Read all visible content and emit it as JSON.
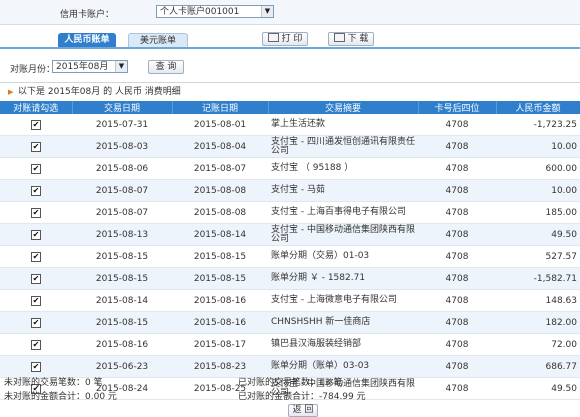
{
  "header": {
    "account_label": "信用卡账户：",
    "account_value": "个人卡账户001001"
  },
  "tabs": [
    {
      "label": "人民币账单",
      "active": true
    },
    {
      "label": "美元账单",
      "active": false
    }
  ],
  "toolbar": {
    "print_label": "打 印",
    "download_label": "下 载"
  },
  "query": {
    "month_label": "对账月份：",
    "month_value": "2015年08月",
    "query_label": "查 询"
  },
  "caption": "以下是 2015年08月 的 人民币 消费明细",
  "table": {
    "headers": [
      "对账请勾选",
      "交易日期",
      "记账日期",
      "交易摘要",
      "卡号后四位",
      "人民币金额"
    ],
    "rows": [
      {
        "checked": true,
        "trade_date": "2015-07-31",
        "post_date": "2015-08-01",
        "desc": "掌上生活还款",
        "card": "4708",
        "amount": "-1,723.25"
      },
      {
        "checked": true,
        "trade_date": "2015-08-03",
        "post_date": "2015-08-04",
        "desc": "支付宝 - 四川通发恒创通讯有限责任公司",
        "card": "4708",
        "amount": "10.00"
      },
      {
        "checked": true,
        "trade_date": "2015-08-06",
        "post_date": "2015-08-07",
        "desc": "支付宝 （ 95188 ）",
        "card": "4708",
        "amount": "600.00"
      },
      {
        "checked": true,
        "trade_date": "2015-08-07",
        "post_date": "2015-08-08",
        "desc": "支付宝 - 马茹",
        "card": "4708",
        "amount": "10.00"
      },
      {
        "checked": true,
        "trade_date": "2015-08-07",
        "post_date": "2015-08-08",
        "desc": "支付宝 - 上海百事得电子有限公司",
        "card": "4708",
        "amount": "185.00"
      },
      {
        "checked": true,
        "trade_date": "2015-08-13",
        "post_date": "2015-08-14",
        "desc": "支付宝 - 中国移动通信集团陕西有限公司",
        "card": "4708",
        "amount": "49.50"
      },
      {
        "checked": true,
        "trade_date": "2015-08-15",
        "post_date": "2015-08-15",
        "desc": "账单分期（交易）01-03",
        "card": "4708",
        "amount": "527.57"
      },
      {
        "checked": true,
        "trade_date": "2015-08-15",
        "post_date": "2015-08-15",
        "desc": "账单分期 ￥ - 1582.71",
        "card": "4708",
        "amount": "-1,582.71"
      },
      {
        "checked": true,
        "trade_date": "2015-08-14",
        "post_date": "2015-08-16",
        "desc": "支付宝 - 上海微意电子有限公司",
        "card": "4708",
        "amount": "148.63"
      },
      {
        "checked": true,
        "trade_date": "2015-08-15",
        "post_date": "2015-08-16",
        "desc": "CHNSHSHH 新一佳商店",
        "card": "4708",
        "amount": "182.00"
      },
      {
        "checked": true,
        "trade_date": "2015-08-16",
        "post_date": "2015-08-17",
        "desc": "镇巴县汉海服装经销部",
        "card": "4708",
        "amount": "72.00"
      },
      {
        "checked": true,
        "trade_date": "2015-06-23",
        "post_date": "2015-08-23",
        "desc": "账单分期（账单）03-03",
        "card": "4708",
        "amount": "686.77"
      },
      {
        "checked": true,
        "trade_date": "2015-08-24",
        "post_date": "2015-08-25",
        "desc": "支付宝 - 中国移动通信集团陕西有限公司",
        "card": "4708",
        "amount": "49.50"
      }
    ]
  },
  "summary": {
    "unchecked_count_label": "未对账的交易笔数：",
    "unchecked_count": "0 笔",
    "unchecked_total_label": "未对账的金额合计：",
    "unchecked_total": "0.00 元",
    "checked_count_label": "已对账的交易笔数：",
    "checked_count": "13 笔",
    "checked_total_label": "已对账的金额合计：",
    "checked_total": "-784.99 元"
  },
  "footer": {
    "back_label": "返 回"
  },
  "colors": {
    "accent": "#2f7fcc",
    "header_bg": "#2f7fcc",
    "row_alt": "#eef4fb"
  }
}
